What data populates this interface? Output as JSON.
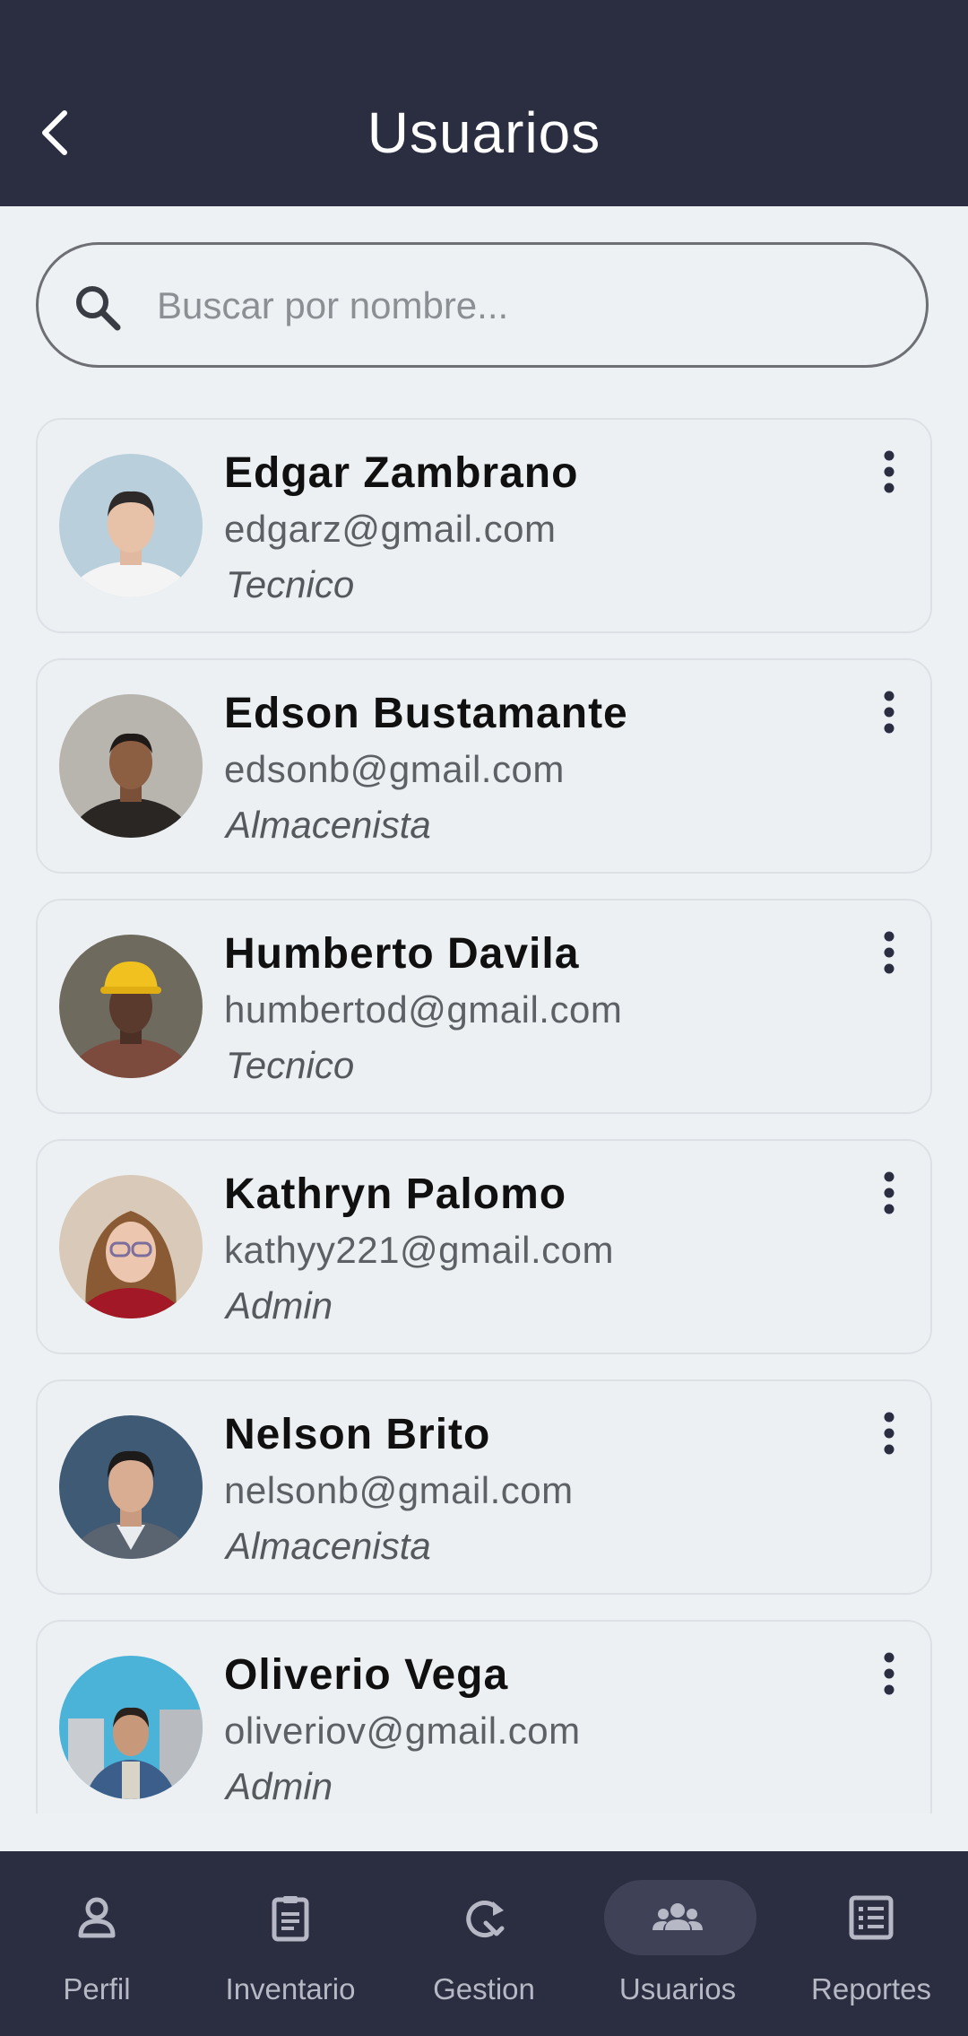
{
  "header": {
    "title": "Usuarios"
  },
  "search": {
    "placeholder": "Buscar por nombre..."
  },
  "users": [
    {
      "name": "Edgar Zambrano",
      "email": "edgarz@gmail.com",
      "role": "Tecnico"
    },
    {
      "name": "Edson Bustamante",
      "email": "edsonb@gmail.com",
      "role": "Almacenista"
    },
    {
      "name": "Humberto Davila",
      "email": "humbertod@gmail.com",
      "role": "Tecnico"
    },
    {
      "name": "Kathryn Palomo",
      "email": "kathyy221@gmail.com",
      "role": "Admin"
    },
    {
      "name": "Nelson Brito",
      "email": "nelsonb@gmail.com",
      "role": "Almacenista"
    },
    {
      "name": "Oliverio Vega",
      "email": "oliveriov@gmail.com",
      "role": "Admin"
    }
  ],
  "nav": {
    "items": [
      {
        "label": "Perfil",
        "icon": "person-icon"
      },
      {
        "label": "Inventario",
        "icon": "clipboard-icon"
      },
      {
        "label": "Gestion",
        "icon": "refresh-wrench-icon"
      },
      {
        "label": "Usuarios",
        "icon": "group-icon",
        "active": true
      },
      {
        "label": "Reportes",
        "icon": "report-list-icon"
      }
    ]
  },
  "colors": {
    "header_bg": "#2b2d40",
    "page_bg": "#eef1f4",
    "card_border": "#dde1e6",
    "nav_active_pill": "#3f4257"
  }
}
